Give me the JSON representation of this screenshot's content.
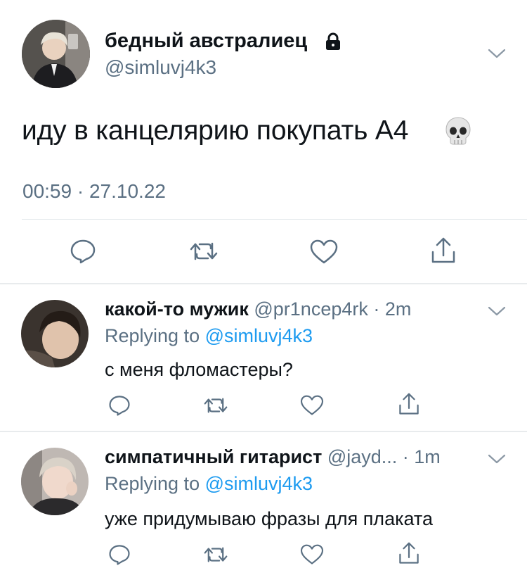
{
  "main_tweet": {
    "display_name": "бедный австралиец",
    "handle": "@simluvj4k3",
    "text": "иду в канцелярию покупать А4",
    "time": "00:59",
    "separator": "·",
    "date": "27.10.22",
    "icons": [
      "lock-icon",
      "skull-emoji",
      "chevron-down-icon",
      "reply-icon",
      "retweet-icon",
      "like-icon",
      "share-icon"
    ]
  },
  "replies": [
    {
      "display_name": "какой-то мужик",
      "handle": "@pr1ncep4rk",
      "time": "· 2m",
      "replying_prefix": "Replying to",
      "replying_to": "@simluvj4k3",
      "text": "с меня фломастеры?"
    },
    {
      "display_name": "симпатичный гитарист",
      "handle": "@jayd...",
      "time": "· 1m",
      "replying_prefix": "Replying to",
      "replying_to": "@simluvj4k3",
      "text": "уже придумываю фразы для плаката"
    }
  ],
  "colors": {
    "text": "#0f1419",
    "secondary": "#5b7083",
    "link": "#1d9bf0",
    "divider": "#e8ebed"
  }
}
